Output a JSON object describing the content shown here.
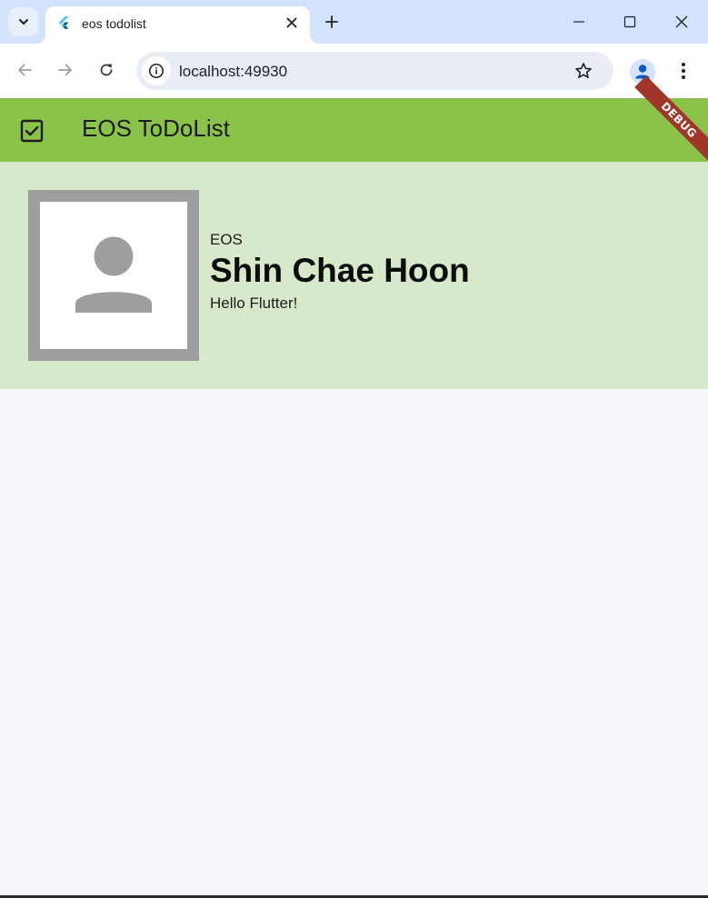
{
  "browser": {
    "tab": {
      "title": "eos todolist",
      "favicon": "flutter-icon"
    },
    "address_bar": {
      "url": "localhost:49930"
    },
    "icons": {
      "tab_search": "chevron-down-icon",
      "tab_close": "close-icon",
      "new_tab": "plus-icon",
      "minimize": "minimize-icon",
      "maximize": "maximize-icon",
      "close_window": "close-icon",
      "back": "arrow-left-icon",
      "forward": "arrow-right-icon",
      "reload": "reload-icon",
      "site_info": "info-icon",
      "bookmark": "star-icon",
      "profile": "account-icon",
      "menu": "more-vert-icon"
    }
  },
  "app": {
    "appbar": {
      "icon": "check-box-icon",
      "title": "EOS ToDoList",
      "debug_banner": "DEBUG"
    },
    "profile": {
      "avatar_icon": "person-icon",
      "org": "EOS",
      "name": "Shin Chae Hoon",
      "greeting": "Hello Flutter!"
    },
    "colors": {
      "appbar_bg": "#8bc34a",
      "profile_bg": "#d8e8ca",
      "avatar_frame": "#9e9e9e",
      "debug_banner": "#a0352a",
      "page_bg": "#f7f8fd"
    }
  }
}
